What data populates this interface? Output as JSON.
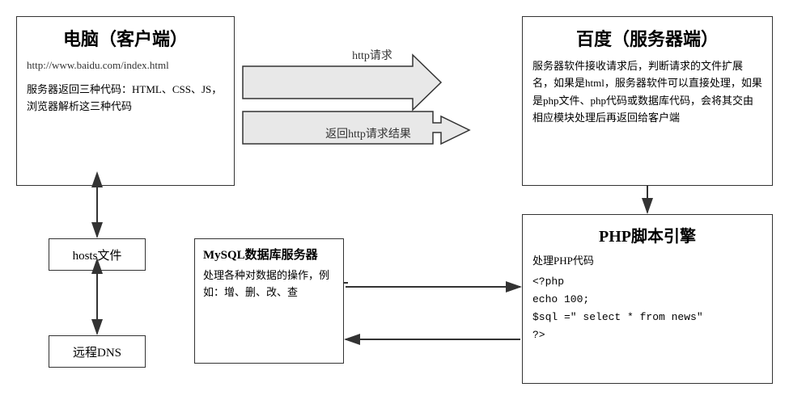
{
  "client": {
    "title": "电脑（客户端）",
    "url": "http://www.baidu.com/index.html",
    "desc": "服务器返回三种代码：HTML、CSS、JS，浏览器解析这三种代码"
  },
  "server": {
    "title": "百度（服务器端）",
    "desc": "服务器软件接收请求后，判断请求的文件扩展名，如果是html，服务器软件可以直接处理，如果是php文件、php代码或数据库代码，会将其交由相应模块处理后再返回给客户端"
  },
  "hosts": {
    "label": "hosts文件"
  },
  "dns": {
    "label": "远程DNS"
  },
  "mysql": {
    "title": "MySQL数据库服务器",
    "desc": "处理各种对数据的操作，例如：增、删、改、查"
  },
  "php": {
    "title": "PHP脚本引擎",
    "desc": "处理PHP代码",
    "code_line1": "<?php",
    "code_line2": "  echo 100;",
    "code_line3": "  $sql =\" select * from news\"",
    "code_line4": "?>"
  },
  "arrows": {
    "http_request": "http请求",
    "http_response": "返回http请求结果"
  }
}
